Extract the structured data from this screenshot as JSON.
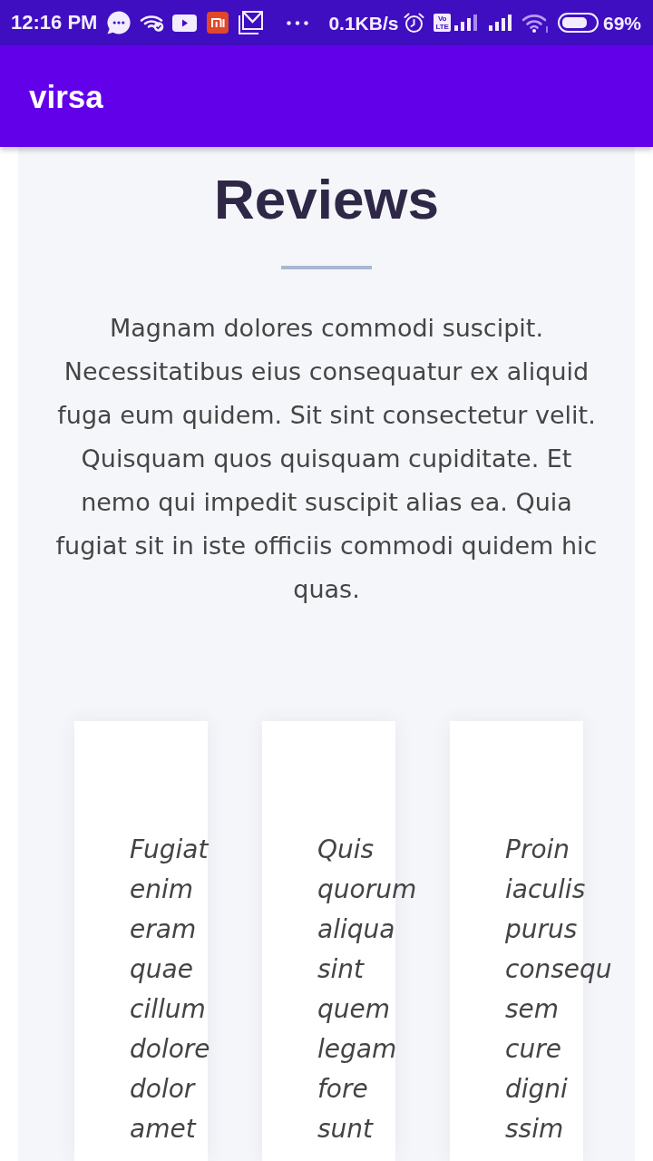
{
  "status_bar": {
    "time": "12:16 PM",
    "network_speed": "0.1KB/s",
    "volte_badge": "Vo LTE",
    "battery": "69%"
  },
  "app_bar": {
    "title": "virsa"
  },
  "section": {
    "title": "Reviews",
    "description": "Magnam dolores commodi suscipit. Necessitatibus eius consequatur ex aliquid fuga eum quidem. Sit sint consectetur velit. Quisquam quos quisquam cupiditate. Et nemo qui impedit suscipit alias ea. Quia fugiat sit in iste officiis commodi quidem hic quas.",
    "testimonials": [
      {
        "text": "Fugiat enim eram quae cillum dolore dolor amet"
      },
      {
        "text": "Quis quorum aliqua sint quem legam fore sunt"
      },
      {
        "text": "Proin iaculis purus consequ sem cure digni ssim"
      }
    ]
  }
}
